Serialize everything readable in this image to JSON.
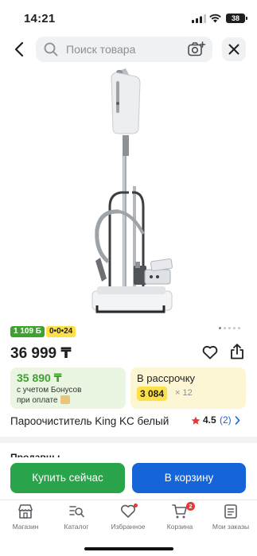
{
  "status_bar": {
    "time": "14:21",
    "battery": "38"
  },
  "header": {
    "search_placeholder": "Поиск товара"
  },
  "gallery": {
    "pages": 5,
    "active_page": 1
  },
  "badges": {
    "bonus": "1 109 Б",
    "installment": "0•0•24"
  },
  "price": "36 999 ₸",
  "bonus_card": {
    "amount": "35 890 ₸",
    "line1": "с учетом Бонусов",
    "line2": "при оплате"
  },
  "installment_card": {
    "title": "В рассрочку",
    "monthly": "3 084",
    "months": "× 12"
  },
  "product": {
    "title": "Пароочиститель King KC белый",
    "rating": "4.5",
    "reviews": "(2)"
  },
  "section_peek": "Продавцы",
  "actions": {
    "buy_now": "Купить сейчас",
    "add_to_cart": "В корзину"
  },
  "tabbar": {
    "items": [
      {
        "label": "Магазин",
        "icon": "shop-icon"
      },
      {
        "label": "Каталог",
        "icon": "catalog-search-icon"
      },
      {
        "label": "Избранное",
        "icon": "heart-icon"
      },
      {
        "label": "Корзина",
        "icon": "cart-icon",
        "badge": "2"
      },
      {
        "label": "Мои заказы",
        "icon": "orders-icon"
      }
    ]
  },
  "colors": {
    "green": "#2aa44a",
    "blue": "#1565d8",
    "yellow": "#fde045",
    "badge_red": "#e53935"
  }
}
